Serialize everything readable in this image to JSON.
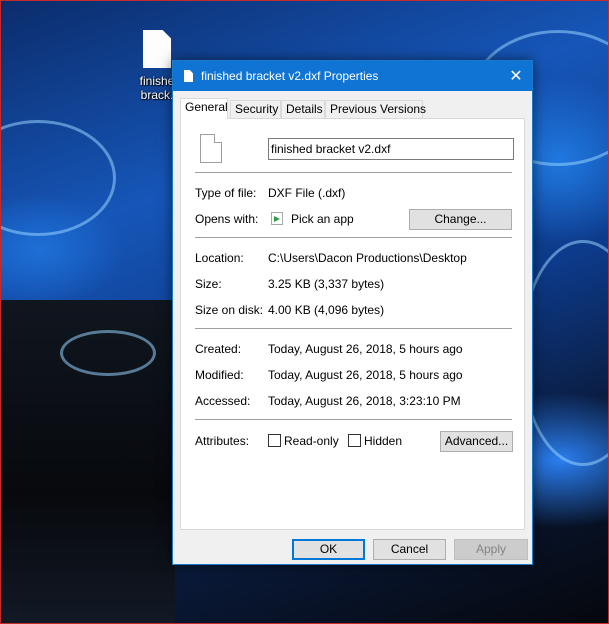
{
  "desktop": {
    "icon_label_line1": "finishe",
    "icon_label_line2": "brack."
  },
  "dialog": {
    "title": "finished bracket v2.dxf Properties",
    "close_glyph": "✕",
    "tabs": [
      {
        "label": "General",
        "active": true
      },
      {
        "label": "Security",
        "active": false
      },
      {
        "label": "Details",
        "active": false
      },
      {
        "label": "Previous Versions",
        "active": false
      }
    ],
    "general": {
      "file_name": "finished bracket v2.dxf",
      "type_label": "Type of file:",
      "type_value": "DXF File (.dxf)",
      "opens_label": "Opens with:",
      "opens_value": "Pick an app",
      "change_button": "Change...",
      "location_label": "Location:",
      "location_value": "C:\\Users\\Dacon Productions\\Desktop",
      "size_label": "Size:",
      "size_value": "3.25 KB (3,337 bytes)",
      "size_on_disk_label": "Size on disk:",
      "size_on_disk_value": "4.00 KB (4,096 bytes)",
      "created_label": "Created:",
      "created_value": "Today, August 26, 2018, 5 hours ago",
      "modified_label": "Modified:",
      "modified_value": "Today, August 26, 2018, 5 hours ago",
      "accessed_label": "Accessed:",
      "accessed_value": "Today, August 26, 2018, 3:23:10 PM",
      "attributes_label": "Attributes:",
      "readonly_label": "Read-only",
      "readonly_checked": false,
      "hidden_label": "Hidden",
      "hidden_checked": false,
      "advanced_button": "Advanced..."
    },
    "buttons": {
      "ok": "OK",
      "cancel": "Cancel",
      "apply": "Apply"
    }
  },
  "colors": {
    "titlebar": "#0f74d4",
    "accent": "#0078d7"
  }
}
